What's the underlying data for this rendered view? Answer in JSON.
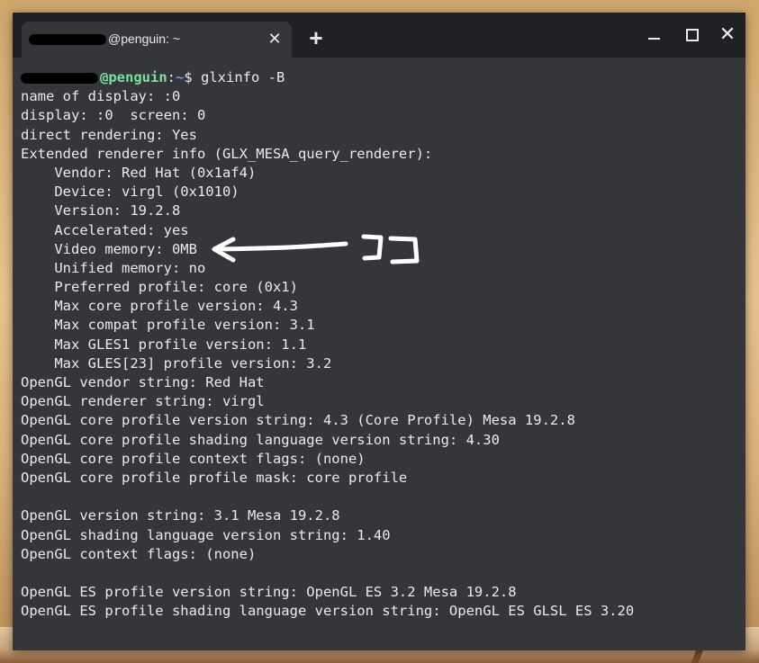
{
  "window": {
    "tab_title": "@penguin: ~",
    "tab_close_label": "✕",
    "new_tab_label": "+",
    "close_label": "✕"
  },
  "prompt": {
    "host": "@penguin",
    "sep": ":",
    "path": "~",
    "symbol": "$ ",
    "command": "glxinfo -B"
  },
  "output": [
    "name of display: :0",
    "display: :0  screen: 0",
    "direct rendering: Yes",
    "Extended renderer info (GLX_MESA_query_renderer):",
    "    Vendor: Red Hat (0x1af4)",
    "    Device: virgl (0x1010)",
    "    Version: 19.2.8",
    "    Accelerated: yes",
    "    Video memory: 0MB",
    "    Unified memory: no",
    "    Preferred profile: core (0x1)",
    "    Max core profile version: 4.3",
    "    Max compat profile version: 3.1",
    "    Max GLES1 profile version: 1.1",
    "    Max GLES[23] profile version: 3.2",
    "OpenGL vendor string: Red Hat",
    "OpenGL renderer string: virgl",
    "OpenGL core profile version string: 4.3 (Core Profile) Mesa 19.2.8",
    "OpenGL core profile shading language version string: 4.30",
    "OpenGL core profile context flags: (none)",
    "OpenGL core profile profile mask: core profile",
    "",
    "OpenGL version string: 3.1 Mesa 19.2.8",
    "OpenGL shading language version string: 1.40",
    "OpenGL context flags: (none)",
    "",
    "OpenGL ES profile version string: OpenGL ES 3.2 Mesa 19.2.8",
    "OpenGL ES profile shading language version string: OpenGL ES GLSL ES 3.20"
  ],
  "annotation": {
    "color": "#ffffff"
  }
}
